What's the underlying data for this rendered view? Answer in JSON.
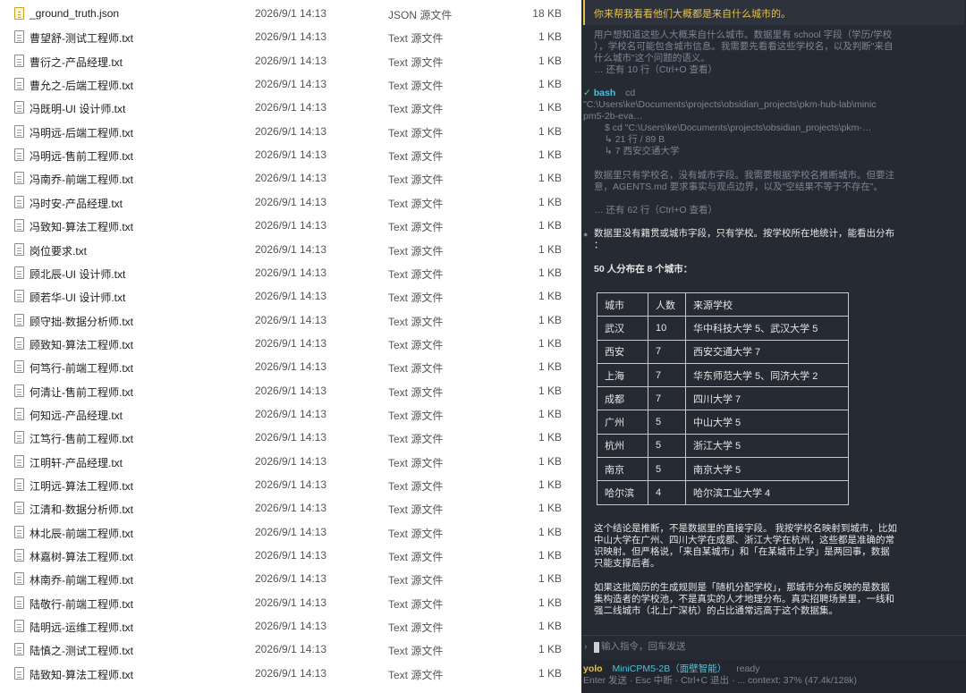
{
  "files": [
    {
      "name": "_ground_truth.json",
      "date": "2026/9/1 14:13",
      "type": "JSON 源文件",
      "size": "18 KB",
      "kind": "json"
    },
    {
      "name": "曹望舒-测试工程师.txt",
      "date": "2026/9/1 14:13",
      "type": "Text 源文件",
      "size": "1 KB",
      "kind": "txt"
    },
    {
      "name": "曹衍之-产品经理.txt",
      "date": "2026/9/1 14:13",
      "type": "Text 源文件",
      "size": "1 KB",
      "kind": "txt"
    },
    {
      "name": "曹允之-后端工程师.txt",
      "date": "2026/9/1 14:13",
      "type": "Text 源文件",
      "size": "1 KB",
      "kind": "txt"
    },
    {
      "name": "冯既明-UI 设计师.txt",
      "date": "2026/9/1 14:13",
      "type": "Text 源文件",
      "size": "1 KB",
      "kind": "txt"
    },
    {
      "name": "冯明远-后端工程师.txt",
      "date": "2026/9/1 14:13",
      "type": "Text 源文件",
      "size": "1 KB",
      "kind": "txt"
    },
    {
      "name": "冯明远-售前工程师.txt",
      "date": "2026/9/1 14:13",
      "type": "Text 源文件",
      "size": "1 KB",
      "kind": "txt"
    },
    {
      "name": "冯南乔-前端工程师.txt",
      "date": "2026/9/1 14:13",
      "type": "Text 源文件",
      "size": "1 KB",
      "kind": "txt"
    },
    {
      "name": "冯时安-产品经理.txt",
      "date": "2026/9/1 14:13",
      "type": "Text 源文件",
      "size": "1 KB",
      "kind": "txt"
    },
    {
      "name": "冯致知-算法工程师.txt",
      "date": "2026/9/1 14:13",
      "type": "Text 源文件",
      "size": "1 KB",
      "kind": "txt"
    },
    {
      "name": "岗位要求.txt",
      "date": "2026/9/1 14:13",
      "type": "Text 源文件",
      "size": "1 KB",
      "kind": "txt"
    },
    {
      "name": "顾北辰-UI 设计师.txt",
      "date": "2026/9/1 14:13",
      "type": "Text 源文件",
      "size": "1 KB",
      "kind": "txt"
    },
    {
      "name": "顾若华-UI 设计师.txt",
      "date": "2026/9/1 14:13",
      "type": "Text 源文件",
      "size": "1 KB",
      "kind": "txt"
    },
    {
      "name": "顾守拙-数据分析师.txt",
      "date": "2026/9/1 14:13",
      "type": "Text 源文件",
      "size": "1 KB",
      "kind": "txt"
    },
    {
      "name": "顾致知-算法工程师.txt",
      "date": "2026/9/1 14:13",
      "type": "Text 源文件",
      "size": "1 KB",
      "kind": "txt"
    },
    {
      "name": "何笃行-前端工程师.txt",
      "date": "2026/9/1 14:13",
      "type": "Text 源文件",
      "size": "1 KB",
      "kind": "txt"
    },
    {
      "name": "何清让-售前工程师.txt",
      "date": "2026/9/1 14:13",
      "type": "Text 源文件",
      "size": "1 KB",
      "kind": "txt"
    },
    {
      "name": "何知远-产品经理.txt",
      "date": "2026/9/1 14:13",
      "type": "Text 源文件",
      "size": "1 KB",
      "kind": "txt"
    },
    {
      "name": "江笃行-售前工程师.txt",
      "date": "2026/9/1 14:13",
      "type": "Text 源文件",
      "size": "1 KB",
      "kind": "txt"
    },
    {
      "name": "江明轩-产品经理.txt",
      "date": "2026/9/1 14:13",
      "type": "Text 源文件",
      "size": "1 KB",
      "kind": "txt"
    },
    {
      "name": "江明远-算法工程师.txt",
      "date": "2026/9/1 14:13",
      "type": "Text 源文件",
      "size": "1 KB",
      "kind": "txt"
    },
    {
      "name": "江清和-数据分析师.txt",
      "date": "2026/9/1 14:13",
      "type": "Text 源文件",
      "size": "1 KB",
      "kind": "txt"
    },
    {
      "name": "林北辰-前端工程师.txt",
      "date": "2026/9/1 14:13",
      "type": "Text 源文件",
      "size": "1 KB",
      "kind": "txt"
    },
    {
      "name": "林嘉树-算法工程师.txt",
      "date": "2026/9/1 14:13",
      "type": "Text 源文件",
      "size": "1 KB",
      "kind": "txt"
    },
    {
      "name": "林南乔-前端工程师.txt",
      "date": "2026/9/1 14:13",
      "type": "Text 源文件",
      "size": "1 KB",
      "kind": "txt"
    },
    {
      "name": "陆敬行-前端工程师.txt",
      "date": "2026/9/1 14:13",
      "type": "Text 源文件",
      "size": "1 KB",
      "kind": "txt"
    },
    {
      "name": "陆明远-运维工程师.txt",
      "date": "2026/9/1 14:13",
      "type": "Text 源文件",
      "size": "1 KB",
      "kind": "txt"
    },
    {
      "name": "陆慎之-测试工程师.txt",
      "date": "2026/9/1 14:13",
      "type": "Text 源文件",
      "size": "1 KB",
      "kind": "txt"
    },
    {
      "name": "陆致知-算法工程师.txt",
      "date": "2026/9/1 14:13",
      "type": "Text 源文件",
      "size": "1 KB",
      "kind": "txt"
    }
  ],
  "terminal": {
    "user_prompt": "你来帮我看看他们大概都是来自什么城市的。",
    "thinking": [
      "用户想知道这些人大概来自什么城市。数据里有 school 字段（学历/学校",
      "），学校名可能包含城市信息。我需要先看看这些学校名，以及判断\"来自",
      "什么城市\"这个问题的语义。"
    ],
    "thinking_more": "… 还有 10 行（Ctrl+O 查看）",
    "bash": {
      "check": "✓",
      "label": "bash",
      "cmd_head": "cd",
      "cmd_lines": [
        "\"C:\\Users\\ke\\Documents\\projects\\obsidian_projects\\pkm-hub-lab\\minic",
        "pm5-2b-eva…"
      ],
      "echo": "$ cd \"C:\\Users\\ke\\Documents\\projects\\obsidian_projects\\pkm-…",
      "result1": "↳ 21 行 / 89 B",
      "result2": "↳ 7 西安交通大学"
    },
    "reasoning": [
      "数据里只有学校名，没有城市字段。我需要根据学校名推断城市。但要注",
      "意，AGENTS.md 要求事实与观点边界，以及\"空结果不等于不存在\"。"
    ],
    "reasoning_more": "… 还有 62 行（Ctrl+O 查看）",
    "answer_lines": [
      "数据里没有籍贯或城市字段，只有学校。按学校所在地统计，能看出分布",
      "："
    ],
    "summary": "50 人分布在 8 个城市：",
    "table": {
      "headers": [
        "城市",
        "人数",
        "来源学校"
      ],
      "rows": [
        [
          "武汉",
          "10",
          "华中科技大学 5、武汉大学 5"
        ],
        [
          "西安",
          "7",
          "西安交通大学 7"
        ],
        [
          "上海",
          "7",
          "华东师范大学 5、同济大学 2"
        ],
        [
          "成都",
          "7",
          "四川大学 7"
        ],
        [
          "广州",
          "5",
          "中山大学 5"
        ],
        [
          "杭州",
          "5",
          "浙江大学 5"
        ],
        [
          "南京",
          "5",
          "南京大学 5"
        ],
        [
          "哈尔滨",
          "4",
          "哈尔滨工业大学 4"
        ]
      ]
    },
    "para1": [
      "这个结论是推断，不是数据里的直接字段。 我按学校名映射到城市，比如",
      "中山大学在广州、四川大学在成都、浙江大学在杭州，这些都是准确的常",
      "识映射。但严格说，「来自某城市」和「在某城市上学」是两回事，数据",
      "只能支撑后者。"
    ],
    "para2": [
      "如果这批简历的生成规则是「随机分配学校」，那城市分布反映的是数据",
      "集构造者的学校池，不是真实的人才地理分布。真实招聘场景里，一线和",
      "强二线城市（北上广深杭）的占比通常远高于这个数据集。"
    ],
    "input_placeholder": "输入指令，回车发送",
    "input_prompt": "›",
    "status": {
      "mode": "yolo",
      "model": "MiniCPM5-2B（面壁智能）",
      "state": "ready",
      "hints": "Enter 发送 · Esc 中断 · Ctrl+C 退出 · ... context: 37% (47.4k/128k)"
    },
    "colors": {
      "background": "#262a33",
      "accent": "#e8c34a",
      "success": "#59d06e",
      "model": "#4fc1d9"
    }
  }
}
